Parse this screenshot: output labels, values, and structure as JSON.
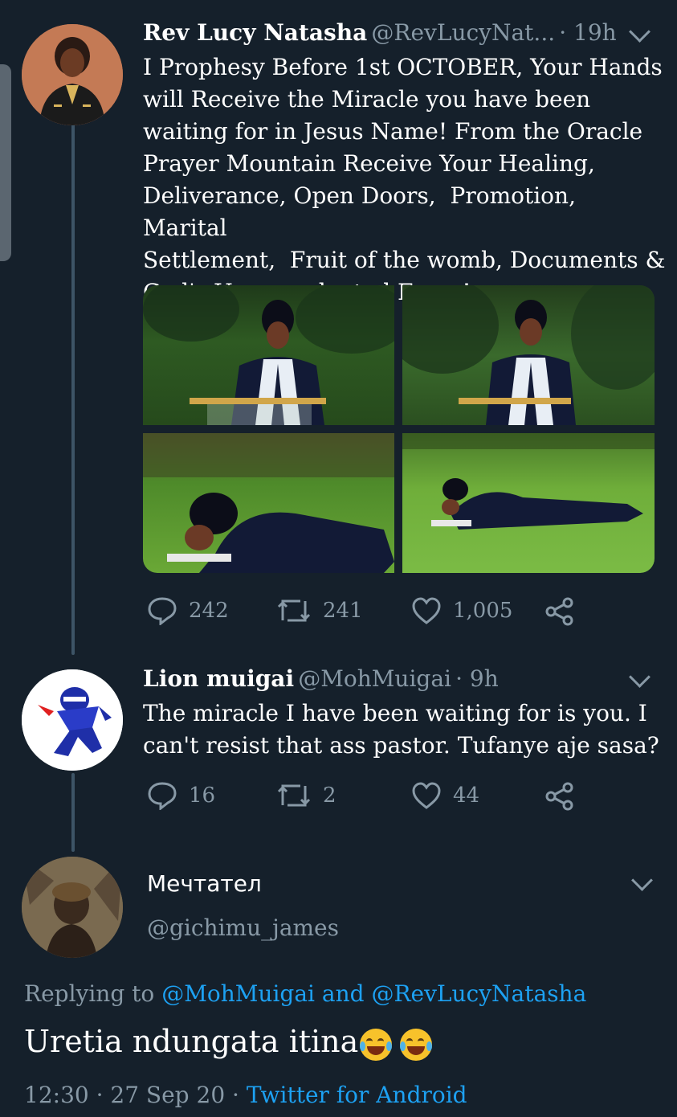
{
  "tweet1": {
    "name": "Rev Lucy Natasha",
    "handle": "@RevLucyNat...",
    "time": "· 19h",
    "text": "I Prophesy Before 1st OCTOBER, Your Hands\nwill Receive the Miracle you have been\nwaiting for in Jesus Name! From the Oracle\nPrayer Mountain Receive Your Healing,\nDeliverance, Open Doors,  Promotion,  Marital\nSettlement,  Fruit of the womb, Documents &\nGod's Unprecedented Favor!",
    "replies": "242",
    "retweets": "241",
    "likes": "1,005"
  },
  "tweet2": {
    "name": "Lion muigai",
    "handle": "@MohMuigai",
    "time": "· 9h",
    "text": "The miracle I have been waiting for is you. I\ncan't resist that ass pastor. Tufanye aje sasa?",
    "replies": "16",
    "retweets": "2",
    "likes": "44"
  },
  "tweet3": {
    "name": "Мечтател",
    "handle": "@gichimu_james",
    "replying_prefix": "Replying to",
    "replying_user1": "@MohMuigai",
    "replying_and": "and",
    "replying_user2": "@RevLucyNatasha",
    "text": "Uretia ndungata itina",
    "timestamp": "12:30 · 27 Sep 20 ·",
    "client": "Twitter for Android"
  },
  "icons": [
    "reply-icon",
    "retweet-icon",
    "like-icon",
    "share-icon",
    "chevron-down-icon",
    "tears-of-joy-emoji"
  ],
  "colors": {
    "background": "#15202b",
    "secondary_text": "#8899a6",
    "link": "#1da1f2",
    "thread_line": "#3d5466"
  }
}
